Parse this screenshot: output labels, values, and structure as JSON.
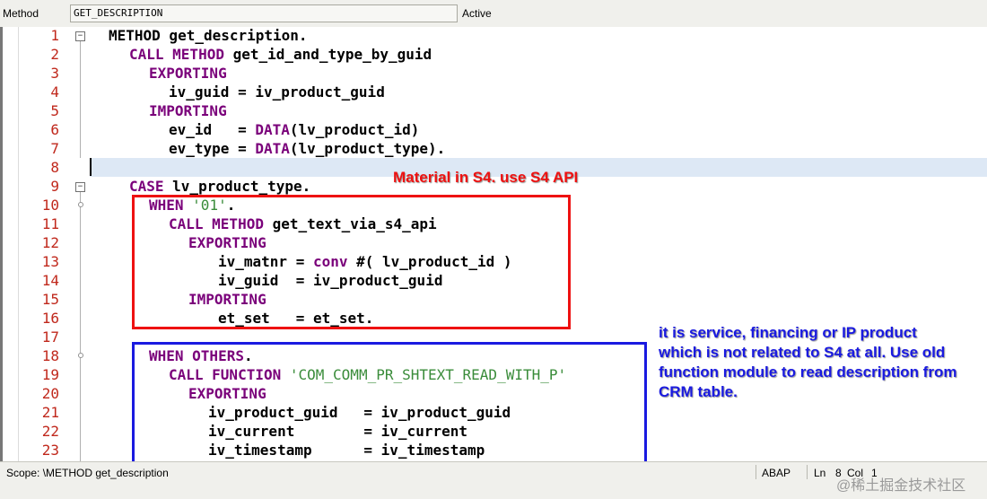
{
  "header": {
    "label": "Method",
    "method_name": "GET_DESCRIPTION",
    "status": "Active"
  },
  "line_numbers": [
    "1",
    "2",
    "3",
    "4",
    "5",
    "6",
    "7",
    "8",
    "9",
    "10",
    "11",
    "12",
    "13",
    "14",
    "15",
    "16",
    "17",
    "18",
    "19",
    "20",
    "21",
    "22",
    "23"
  ],
  "code": {
    "l1": [
      "METHOD",
      " get_description."
    ],
    "l2": [
      "CALL METHOD",
      " get_id_and_type_by_guid"
    ],
    "l3": [
      "EXPORTING"
    ],
    "l4": [
      "iv_guid = iv_product_guid"
    ],
    "l5": [
      "IMPORTING"
    ],
    "l6": [
      "ev_id   = ",
      "DATA",
      "(lv_product_id)"
    ],
    "l7": [
      "ev_type = ",
      "DATA",
      "(lv_product_type)."
    ],
    "l9": [
      "CASE",
      " lv_product_type."
    ],
    "l10": [
      "WHEN",
      " ",
      "'01'",
      "."
    ],
    "l11": [
      "CALL METHOD",
      " get_text_via_s4_api"
    ],
    "l12": [
      "EXPORTING"
    ],
    "l13": [
      "iv_matnr = ",
      "conv",
      " #( lv_product_id )"
    ],
    "l14": [
      "iv_guid  = iv_product_guid"
    ],
    "l15": [
      "IMPORTING"
    ],
    "l16": [
      "et_set   = et_set."
    ],
    "l18": [
      "WHEN OTHERS",
      "."
    ],
    "l19": [
      "CALL FUNCTION",
      " ",
      "'COM_COMM_PR_SHTEXT_READ_WITH_P'"
    ],
    "l20": [
      "EXPORTING"
    ],
    "l21": [
      "iv_product_guid   = iv_product_guid"
    ],
    "l22": [
      "iv_current        = iv_current"
    ],
    "l23": [
      "iv_timestamp      = iv_timestamp"
    ]
  },
  "annotations": {
    "red_note": "Material in S4. use S4 API",
    "blue_note": "it is service, financing or IP product which is not related to S4 at all. Use old function module to read description from CRM table."
  },
  "statusbar": {
    "scope": "Scope: \\METHOD get_description",
    "language": "ABAP",
    "ln_label": "Ln",
    "ln_value": "8",
    "col_label": "Col",
    "col_value": "1"
  },
  "watermark": "@稀土掘金技术社区",
  "colors": {
    "keyword": "#7a007a",
    "string": "#3a8c3a",
    "line_number": "#c0281c",
    "red_box": "#ee1111",
    "blue_box": "#1a1ae0"
  }
}
